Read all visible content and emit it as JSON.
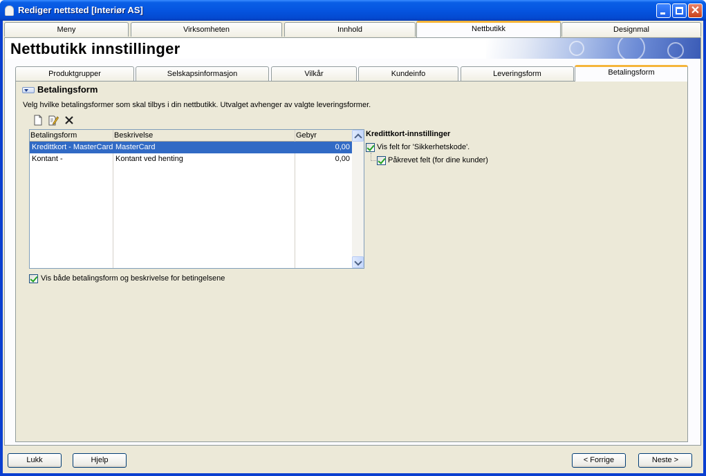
{
  "window": {
    "title": "Rediger nettsted [Interiør AS]",
    "controls": {
      "minimize_icon": "minimize-icon",
      "maximize_icon": "maximize-icon",
      "close_icon": "close-icon",
      "close_glyph": "✕"
    }
  },
  "main_tabs": [
    {
      "label": "Meny"
    },
    {
      "label": "Virksomheten"
    },
    {
      "label": "Innhold"
    },
    {
      "label": "Nettbutikk",
      "active": true
    },
    {
      "label": "Designmal"
    }
  ],
  "page": {
    "title": "Nettbutikk innstillinger"
  },
  "sub_tabs": [
    {
      "label": "Produktgrupper"
    },
    {
      "label": "Selskapsinformasjon"
    },
    {
      "label": "Vilkår"
    },
    {
      "label": "Kundeinfo"
    },
    {
      "label": "Leveringsform"
    },
    {
      "label": "Betalingsform",
      "active": true
    }
  ],
  "section": {
    "title": "Betalingsform",
    "description": "Velg hvilke betalingsformer som skal tilbys i din nettbutikk. Utvalget avhenger av valgte leveringsformer.",
    "toolbar": [
      "new-document-icon",
      "edit-document-icon",
      "delete-icon"
    ]
  },
  "grid": {
    "columns": [
      "Betalingsform",
      "Beskrivelse",
      "Gebyr"
    ],
    "rows": [
      {
        "betalingsform": "Kredittkort - MasterCard",
        "beskrivelse": "MasterCard",
        "gebyr": "0,00",
        "selected": true
      },
      {
        "betalingsform": "Kontant -",
        "beskrivelse": "Kontant ved henting",
        "gebyr": "0,00",
        "selected": false
      }
    ]
  },
  "show_both": {
    "label": "Vis både betalingsform og beskrivelse for betingelsene",
    "checked": true
  },
  "kredittkort": {
    "title": "Kredittkort-innstillinger",
    "show_security_code": {
      "label": "Vis felt for 'Sikkerhetskode'.",
      "checked": true
    },
    "required_field": {
      "label": "Påkrevet felt (for dine kunder)",
      "checked": true
    }
  },
  "footer": {
    "close": "Lukk",
    "help": "Hjelp",
    "previous": "< Forrige",
    "next": "Neste >"
  },
  "colors": {
    "accent": "#f5b53a",
    "selection": "#316ac5",
    "titlebar": "#0555e0"
  }
}
